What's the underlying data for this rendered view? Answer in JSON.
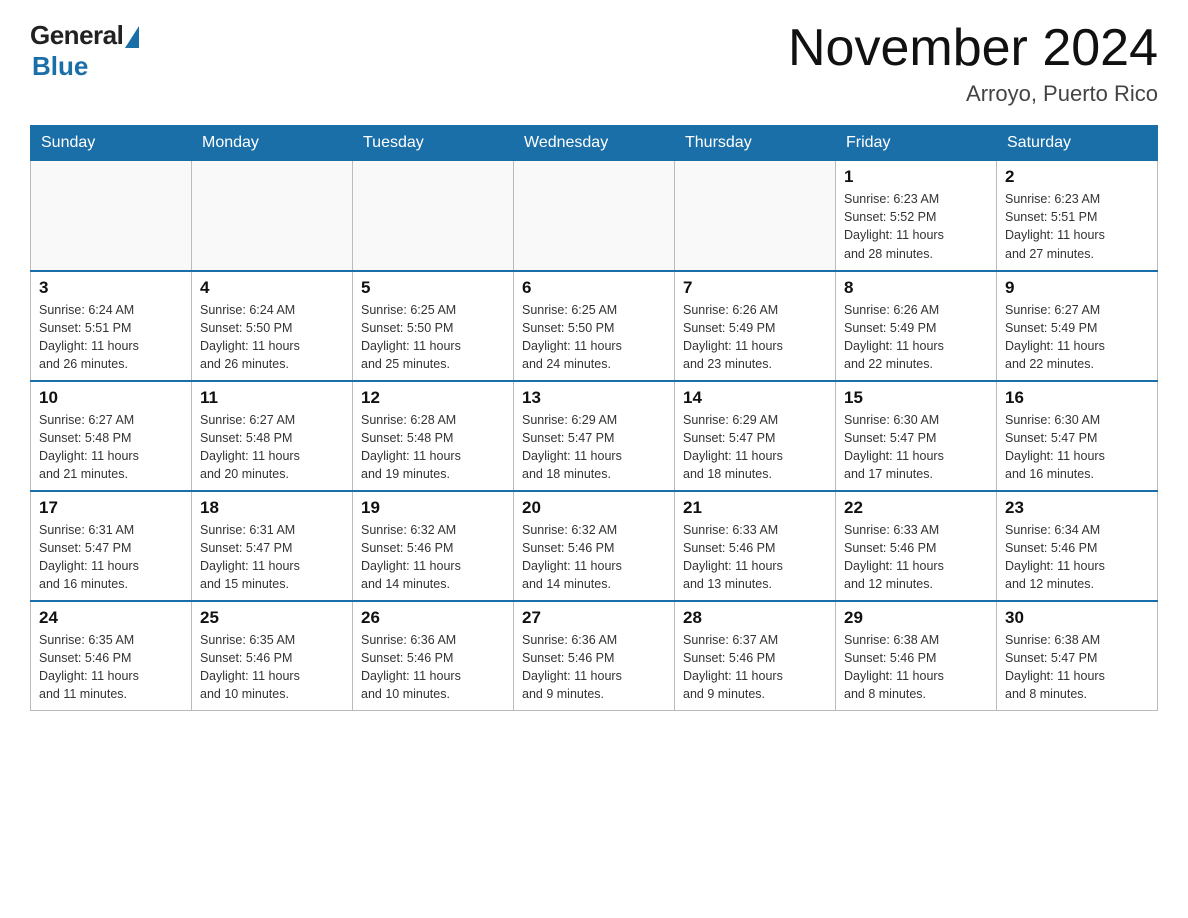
{
  "logo": {
    "general": "General",
    "blue": "Blue"
  },
  "title": "November 2024",
  "subtitle": "Arroyo, Puerto Rico",
  "days_of_week": [
    "Sunday",
    "Monday",
    "Tuesday",
    "Wednesday",
    "Thursday",
    "Friday",
    "Saturday"
  ],
  "weeks": [
    [
      {
        "day": "",
        "info": ""
      },
      {
        "day": "",
        "info": ""
      },
      {
        "day": "",
        "info": ""
      },
      {
        "day": "",
        "info": ""
      },
      {
        "day": "",
        "info": ""
      },
      {
        "day": "1",
        "info": "Sunrise: 6:23 AM\nSunset: 5:52 PM\nDaylight: 11 hours\nand 28 minutes."
      },
      {
        "day": "2",
        "info": "Sunrise: 6:23 AM\nSunset: 5:51 PM\nDaylight: 11 hours\nand 27 minutes."
      }
    ],
    [
      {
        "day": "3",
        "info": "Sunrise: 6:24 AM\nSunset: 5:51 PM\nDaylight: 11 hours\nand 26 minutes."
      },
      {
        "day": "4",
        "info": "Sunrise: 6:24 AM\nSunset: 5:50 PM\nDaylight: 11 hours\nand 26 minutes."
      },
      {
        "day": "5",
        "info": "Sunrise: 6:25 AM\nSunset: 5:50 PM\nDaylight: 11 hours\nand 25 minutes."
      },
      {
        "day": "6",
        "info": "Sunrise: 6:25 AM\nSunset: 5:50 PM\nDaylight: 11 hours\nand 24 minutes."
      },
      {
        "day": "7",
        "info": "Sunrise: 6:26 AM\nSunset: 5:49 PM\nDaylight: 11 hours\nand 23 minutes."
      },
      {
        "day": "8",
        "info": "Sunrise: 6:26 AM\nSunset: 5:49 PM\nDaylight: 11 hours\nand 22 minutes."
      },
      {
        "day": "9",
        "info": "Sunrise: 6:27 AM\nSunset: 5:49 PM\nDaylight: 11 hours\nand 22 minutes."
      }
    ],
    [
      {
        "day": "10",
        "info": "Sunrise: 6:27 AM\nSunset: 5:48 PM\nDaylight: 11 hours\nand 21 minutes."
      },
      {
        "day": "11",
        "info": "Sunrise: 6:27 AM\nSunset: 5:48 PM\nDaylight: 11 hours\nand 20 minutes."
      },
      {
        "day": "12",
        "info": "Sunrise: 6:28 AM\nSunset: 5:48 PM\nDaylight: 11 hours\nand 19 minutes."
      },
      {
        "day": "13",
        "info": "Sunrise: 6:29 AM\nSunset: 5:47 PM\nDaylight: 11 hours\nand 18 minutes."
      },
      {
        "day": "14",
        "info": "Sunrise: 6:29 AM\nSunset: 5:47 PM\nDaylight: 11 hours\nand 18 minutes."
      },
      {
        "day": "15",
        "info": "Sunrise: 6:30 AM\nSunset: 5:47 PM\nDaylight: 11 hours\nand 17 minutes."
      },
      {
        "day": "16",
        "info": "Sunrise: 6:30 AM\nSunset: 5:47 PM\nDaylight: 11 hours\nand 16 minutes."
      }
    ],
    [
      {
        "day": "17",
        "info": "Sunrise: 6:31 AM\nSunset: 5:47 PM\nDaylight: 11 hours\nand 16 minutes."
      },
      {
        "day": "18",
        "info": "Sunrise: 6:31 AM\nSunset: 5:47 PM\nDaylight: 11 hours\nand 15 minutes."
      },
      {
        "day": "19",
        "info": "Sunrise: 6:32 AM\nSunset: 5:46 PM\nDaylight: 11 hours\nand 14 minutes."
      },
      {
        "day": "20",
        "info": "Sunrise: 6:32 AM\nSunset: 5:46 PM\nDaylight: 11 hours\nand 14 minutes."
      },
      {
        "day": "21",
        "info": "Sunrise: 6:33 AM\nSunset: 5:46 PM\nDaylight: 11 hours\nand 13 minutes."
      },
      {
        "day": "22",
        "info": "Sunrise: 6:33 AM\nSunset: 5:46 PM\nDaylight: 11 hours\nand 12 minutes."
      },
      {
        "day": "23",
        "info": "Sunrise: 6:34 AM\nSunset: 5:46 PM\nDaylight: 11 hours\nand 12 minutes."
      }
    ],
    [
      {
        "day": "24",
        "info": "Sunrise: 6:35 AM\nSunset: 5:46 PM\nDaylight: 11 hours\nand 11 minutes."
      },
      {
        "day": "25",
        "info": "Sunrise: 6:35 AM\nSunset: 5:46 PM\nDaylight: 11 hours\nand 10 minutes."
      },
      {
        "day": "26",
        "info": "Sunrise: 6:36 AM\nSunset: 5:46 PM\nDaylight: 11 hours\nand 10 minutes."
      },
      {
        "day": "27",
        "info": "Sunrise: 6:36 AM\nSunset: 5:46 PM\nDaylight: 11 hours\nand 9 minutes."
      },
      {
        "day": "28",
        "info": "Sunrise: 6:37 AM\nSunset: 5:46 PM\nDaylight: 11 hours\nand 9 minutes."
      },
      {
        "day": "29",
        "info": "Sunrise: 6:38 AM\nSunset: 5:46 PM\nDaylight: 11 hours\nand 8 minutes."
      },
      {
        "day": "30",
        "info": "Sunrise: 6:38 AM\nSunset: 5:47 PM\nDaylight: 11 hours\nand 8 minutes."
      }
    ]
  ]
}
